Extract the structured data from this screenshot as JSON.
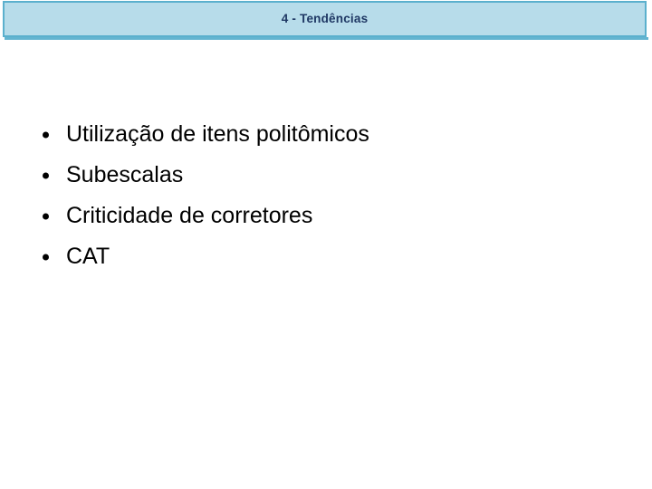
{
  "slide": {
    "title": "4 - Tendências",
    "title_bar": {
      "background_color": "#b7dcea",
      "border_color": "#5bb0cd",
      "text_color": "#1f3864"
    },
    "background_color": "#ffffff",
    "bullets": [
      {
        "text": "Utilização de itens politômicos",
        "marker": "bullet-dot"
      },
      {
        "text": "Subescalas",
        "marker": "bullet-dot"
      },
      {
        "text": "Criticidade de corretores",
        "marker": "bullet-dot"
      },
      {
        "text": "CAT",
        "marker": "bullet-dot"
      }
    ]
  }
}
